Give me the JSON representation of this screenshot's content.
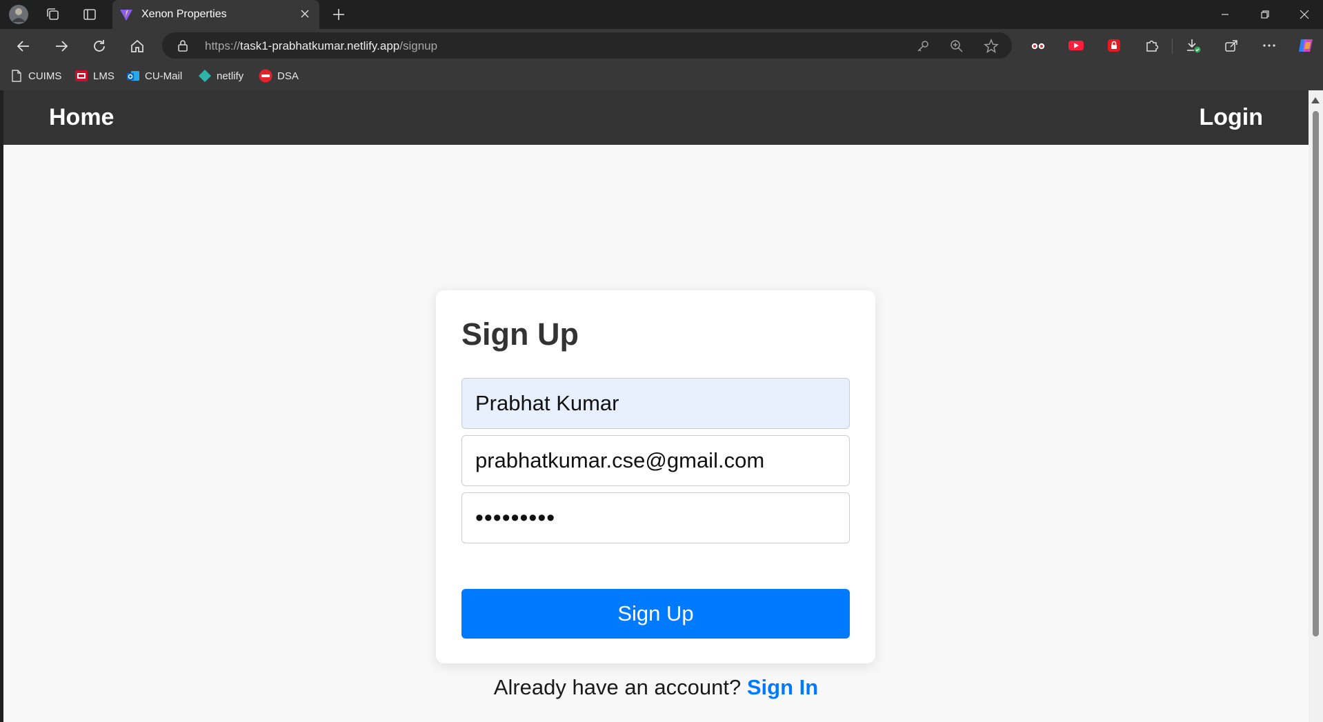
{
  "browser": {
    "tab_title": "Xenon Properties",
    "address": {
      "scheme": "https://",
      "host": "task1-prabhatkumar.netlify.app",
      "path": "/signup"
    },
    "bookmarks": [
      {
        "label": "CUIMS",
        "icon": "page-icon"
      },
      {
        "label": "LMS",
        "icon": "lms-icon"
      },
      {
        "label": "CU-Mail",
        "icon": "outlook-icon"
      },
      {
        "label": "netlify",
        "icon": "netlify-icon"
      },
      {
        "label": "DSA",
        "icon": "tuf-icon"
      }
    ],
    "colors": {
      "chrome_dark": "#202020",
      "chrome_toolbar": "#383838"
    }
  },
  "site": {
    "nav": {
      "home": "Home",
      "login": "Login"
    },
    "signup": {
      "title": "Sign Up",
      "name_value": "Prabhat Kumar",
      "email_value": "prabhatkumar.cse@gmail.com",
      "password_mask": "•••••••••",
      "submit_label": "Sign Up",
      "footer_text": "Already have an account?",
      "footer_link": "Sign In"
    },
    "colors": {
      "accent": "#007bff",
      "nav_bg": "#333333",
      "autofill_bg": "#e8f0fe"
    }
  }
}
